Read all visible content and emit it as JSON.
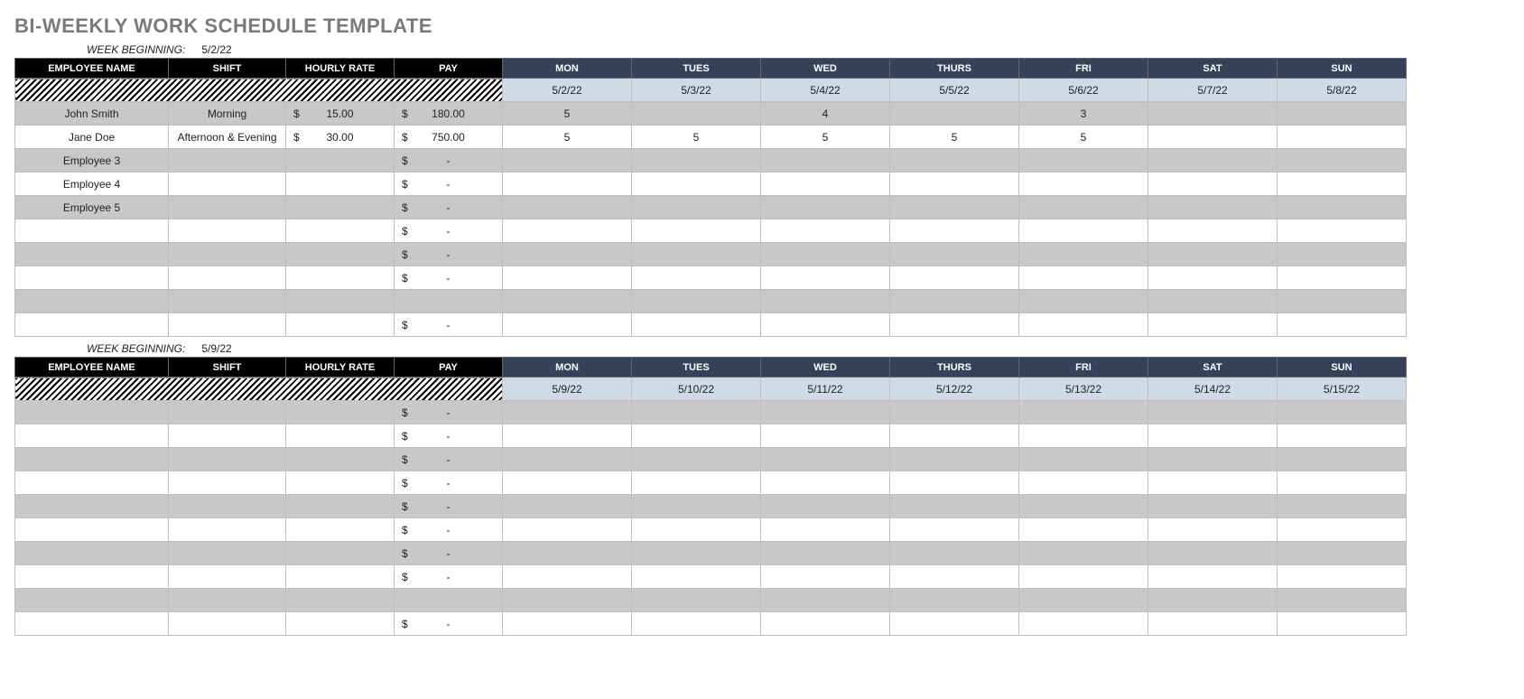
{
  "title": "BI-WEEKLY WORK SCHEDULE TEMPLATE",
  "labels": {
    "week_beginning": "WEEK BEGINNING:",
    "employee_name": "EMPLOYEE NAME",
    "shift": "SHIFT",
    "hourly_rate": "HOURLY RATE",
    "pay": "PAY",
    "days": [
      "MON",
      "TUES",
      "WED",
      "THURS",
      "FRI",
      "SAT",
      "SUN"
    ]
  },
  "currency_symbol": "$",
  "dash": "-",
  "weeks": [
    {
      "beginning": "5/2/22",
      "dates": [
        "5/2/22",
        "5/3/22",
        "5/4/22",
        "5/5/22",
        "5/6/22",
        "5/7/22",
        "5/8/22"
      ],
      "rows": [
        {
          "name": "John Smith",
          "shift": "Morning",
          "rate_sign": "$",
          "rate": "15.00",
          "pay_sign": "$",
          "pay": "180.00",
          "days": [
            "5",
            "",
            "4",
            "",
            "3",
            "",
            ""
          ]
        },
        {
          "name": "Jane Doe",
          "shift": "Afternoon & Evening",
          "rate_sign": "$",
          "rate": "30.00",
          "pay_sign": "$",
          "pay": "750.00",
          "days": [
            "5",
            "5",
            "5",
            "5",
            "5",
            "",
            ""
          ]
        },
        {
          "name": "Employee 3",
          "shift": "",
          "rate_sign": "",
          "rate": "",
          "pay_sign": "$",
          "pay": "-",
          "days": [
            "",
            "",
            "",
            "",
            "",
            "",
            ""
          ]
        },
        {
          "name": "Employee 4",
          "shift": "",
          "rate_sign": "",
          "rate": "",
          "pay_sign": "$",
          "pay": "-",
          "days": [
            "",
            "",
            "",
            "",
            "",
            "",
            ""
          ]
        },
        {
          "name": "Employee 5",
          "shift": "",
          "rate_sign": "",
          "rate": "",
          "pay_sign": "$",
          "pay": "-",
          "days": [
            "",
            "",
            "",
            "",
            "",
            "",
            ""
          ]
        },
        {
          "name": "",
          "shift": "",
          "rate_sign": "",
          "rate": "",
          "pay_sign": "$",
          "pay": "-",
          "days": [
            "",
            "",
            "",
            "",
            "",
            "",
            ""
          ]
        },
        {
          "name": "",
          "shift": "",
          "rate_sign": "",
          "rate": "",
          "pay_sign": "$",
          "pay": "-",
          "days": [
            "",
            "",
            "",
            "",
            "",
            "",
            ""
          ]
        },
        {
          "name": "",
          "shift": "",
          "rate_sign": "",
          "rate": "",
          "pay_sign": "$",
          "pay": "-",
          "days": [
            "",
            "",
            "",
            "",
            "",
            "",
            ""
          ]
        },
        {
          "name": "",
          "shift": "",
          "rate_sign": "",
          "rate": "",
          "pay_sign": "",
          "pay": "",
          "days": [
            "",
            "",
            "",
            "",
            "",
            "",
            ""
          ]
        },
        {
          "name": "",
          "shift": "",
          "rate_sign": "",
          "rate": "",
          "pay_sign": "$",
          "pay": "-",
          "days": [
            "",
            "",
            "",
            "",
            "",
            "",
            ""
          ]
        }
      ]
    },
    {
      "beginning": "5/9/22",
      "dates": [
        "5/9/22",
        "5/10/22",
        "5/11/22",
        "5/12/22",
        "5/13/22",
        "5/14/22",
        "5/15/22"
      ],
      "rows": [
        {
          "name": "",
          "shift": "",
          "rate_sign": "",
          "rate": "",
          "pay_sign": "$",
          "pay": "-",
          "days": [
            "",
            "",
            "",
            "",
            "",
            "",
            ""
          ]
        },
        {
          "name": "",
          "shift": "",
          "rate_sign": "",
          "rate": "",
          "pay_sign": "$",
          "pay": "-",
          "days": [
            "",
            "",
            "",
            "",
            "",
            "",
            ""
          ]
        },
        {
          "name": "",
          "shift": "",
          "rate_sign": "",
          "rate": "",
          "pay_sign": "$",
          "pay": "-",
          "days": [
            "",
            "",
            "",
            "",
            "",
            "",
            ""
          ]
        },
        {
          "name": "",
          "shift": "",
          "rate_sign": "",
          "rate": "",
          "pay_sign": "$",
          "pay": "-",
          "days": [
            "",
            "",
            "",
            "",
            "",
            "",
            ""
          ]
        },
        {
          "name": "",
          "shift": "",
          "rate_sign": "",
          "rate": "",
          "pay_sign": "$",
          "pay": "-",
          "days": [
            "",
            "",
            "",
            "",
            "",
            "",
            ""
          ]
        },
        {
          "name": "",
          "shift": "",
          "rate_sign": "",
          "rate": "",
          "pay_sign": "$",
          "pay": "-",
          "days": [
            "",
            "",
            "",
            "",
            "",
            "",
            ""
          ]
        },
        {
          "name": "",
          "shift": "",
          "rate_sign": "",
          "rate": "",
          "pay_sign": "$",
          "pay": "-",
          "days": [
            "",
            "",
            "",
            "",
            "",
            "",
            ""
          ]
        },
        {
          "name": "",
          "shift": "",
          "rate_sign": "",
          "rate": "",
          "pay_sign": "$",
          "pay": "-",
          "days": [
            "",
            "",
            "",
            "",
            "",
            "",
            ""
          ]
        },
        {
          "name": "",
          "shift": "",
          "rate_sign": "",
          "rate": "",
          "pay_sign": "",
          "pay": "",
          "days": [
            "",
            "",
            "",
            "",
            "",
            "",
            ""
          ]
        },
        {
          "name": "",
          "shift": "",
          "rate_sign": "",
          "rate": "",
          "pay_sign": "$",
          "pay": "-",
          "days": [
            "",
            "",
            "",
            "",
            "",
            "",
            ""
          ]
        }
      ]
    }
  ]
}
